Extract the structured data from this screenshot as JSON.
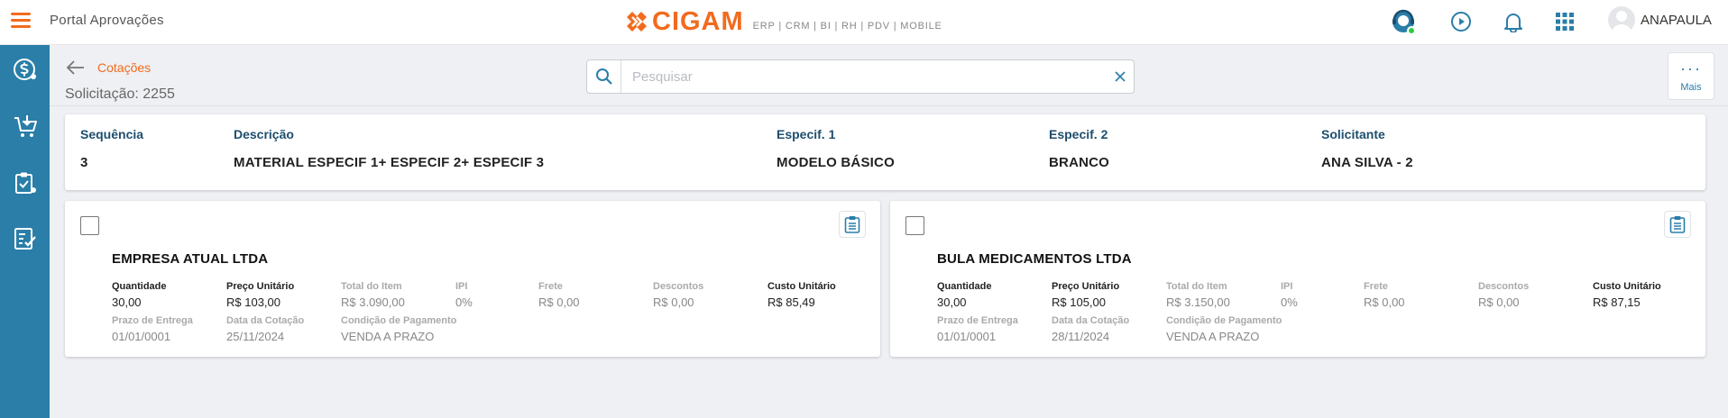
{
  "header": {
    "app_title": "Portal Aprovações",
    "logo_text": "CIGAM",
    "logo_tagline": "ERP | CRM | BI | RH | PDV | MOBILE",
    "user_name": "ANAPAULA",
    "brand_color": "#f26b1d",
    "accent_color": "#2a7ea8"
  },
  "sidebar": {
    "items": [
      {
        "icon": "dollar-circle-icon"
      },
      {
        "icon": "cart-download-icon"
      },
      {
        "icon": "clipboard-check-icon"
      },
      {
        "icon": "checklist-icon"
      }
    ]
  },
  "page": {
    "breadcrumb": "Cotações",
    "subtitle": "Solicitação: 2255",
    "search_placeholder": "Pesquisar",
    "search_value": "",
    "more_label": "Mais",
    "more_dots": "···"
  },
  "info": {
    "sequencia_label": "Sequência",
    "sequencia_value": "3",
    "descricao_label": "Descrição",
    "descricao_value": "MATERIAL ESPECIF 1+ ESPECIF 2+ ESPECIF 3",
    "especif1_label": "Especif. 1",
    "especif1_value": "MODELO BÁSICO",
    "especif2_label": "Especif. 2",
    "especif2_value": "BRANCO",
    "solicitante_label": "Solicitante",
    "solicitante_value": "ANA SILVA - 2"
  },
  "labels": {
    "quantidade": "Quantidade",
    "preco_unitario": "Preço Unitário",
    "total_item": "Total do Item",
    "ipi": "IPI",
    "frete": "Frete",
    "descontos": "Descontos",
    "custo_unitario": "Custo Unitário",
    "prazo_entrega": "Prazo de Entrega",
    "data_cotacao": "Data da Cotação",
    "condicao_pagamento": "Condição de Pagamento"
  },
  "quotes": [
    {
      "supplier": "EMPRESA ATUAL LTDA",
      "quantidade": "30,00",
      "preco_unitario": "R$ 103,00",
      "total_item": "R$ 3.090,00",
      "ipi": "0%",
      "frete": "R$ 0,00",
      "descontos": "R$ 0,00",
      "custo_unitario": "R$ 85,49",
      "prazo_entrega": "01/01/0001",
      "data_cotacao": "25/11/2024",
      "condicao_pagamento": "VENDA A PRAZO"
    },
    {
      "supplier": "BULA MEDICAMENTOS LTDA",
      "quantidade": "30,00",
      "preco_unitario": "R$ 105,00",
      "total_item": "R$ 3.150,00",
      "ipi": "0%",
      "frete": "R$ 0,00",
      "descontos": "R$ 0,00",
      "custo_unitario": "R$ 87,15",
      "prazo_entrega": "01/01/0001",
      "data_cotacao": "28/11/2024",
      "condicao_pagamento": "VENDA A PRAZO"
    }
  ]
}
